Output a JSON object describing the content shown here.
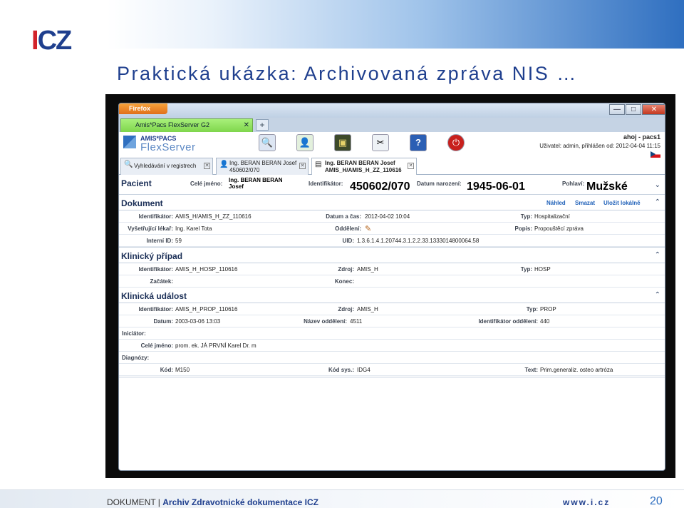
{
  "slide": {
    "logo_left": "I",
    "logo_right": "CZ",
    "title": "Praktická ukázka: Archivovaná zpráva NIS …"
  },
  "browser": {
    "app_button": "Firefox",
    "tab_title": "Amis*Pacs FlexServer G2",
    "new_tab": "+",
    "minimize": "—",
    "maximize": "□",
    "close": "✕"
  },
  "app": {
    "brand_top": "AMIS*PACS",
    "brand_bottom": "FlexServer",
    "tools": [
      {
        "icon": "search-icon",
        "glyph": "🔍"
      },
      {
        "icon": "user-add-icon",
        "glyph": "👤"
      },
      {
        "icon": "monitor-icon",
        "glyph": "▣"
      },
      {
        "icon": "tools-icon",
        "glyph": "✂"
      },
      {
        "icon": "help-icon",
        "glyph": "?"
      },
      {
        "icon": "power-icon",
        "glyph": "⏻"
      }
    ],
    "greeting": "ahoj - pacs1",
    "user_line": "Uživatel: admin, přihlášen od: 2012-04-04 11:15",
    "tabs": [
      {
        "line1": "Vyhledávání v registrech",
        "line2": ""
      },
      {
        "line1": "Ing. BERAN BERAN Josef",
        "line2": "450602/070"
      },
      {
        "line1": "Ing. BERAN BERAN Josef",
        "line2": "AMIS_H/AMIS_H_ZZ_110616"
      }
    ]
  },
  "patient": {
    "title": "Pacient",
    "name_label": "Celé jméno:",
    "name_value_1": "Ing. BERAN BERAN",
    "name_value_2": "Josef",
    "id_label": "Identifikátor:",
    "id_value": "450602/070",
    "dob_label": "Datum narození:",
    "dob_value": "1945-06-01",
    "sex_label": "Pohlaví:",
    "sex_value": "Mužské"
  },
  "document": {
    "title": "Dokument",
    "actions": [
      "Náhled",
      "Smazat",
      "Uložit lokálně"
    ],
    "rows": [
      {
        "l1": "Identifikátor:",
        "v1": "AMIS_H/AMIS_H_ZZ_110616",
        "l2": "Datum a čas:",
        "v2": "2012-04-02 10:04",
        "l3": "Typ:",
        "v3": "Hospitalizační"
      },
      {
        "l1": "Vyšetřující lékař:",
        "v1": "Ing. Karel Tota",
        "l2": "Oddělení:",
        "v2": "✎",
        "l3": "Popis:",
        "v3": "Propouštěcí zpráva"
      },
      {
        "l1": "Interní ID:",
        "v1": "59",
        "l2": "UID:",
        "v2": "1.3.6.1.4.1.20744.3.1.2.2.33.1333014800064.58",
        "l3": "",
        "v3": ""
      }
    ]
  },
  "clinical_case": {
    "title": "Klinický případ",
    "rows": [
      {
        "l1": "Identifikátor:",
        "v1": "AMIS_H_HOSP_110616",
        "l2": "Zdroj:",
        "v2": "AMIS_H",
        "l3": "Typ:",
        "v3": "HOSP"
      },
      {
        "l1": "Začátek:",
        "v1": "",
        "l2": "Konec:",
        "v2": "",
        "l3": "",
        "v3": ""
      }
    ]
  },
  "clinical_event": {
    "title": "Klinická událost",
    "row1": {
      "l1": "Identifikátor:",
      "v1": "AMIS_H_PROP_110616",
      "l2": "Zdroj:",
      "v2": "AMIS_H",
      "l3": "Typ:",
      "v3": "PROP"
    },
    "row2": {
      "l1": "Datum:",
      "v1": "2003-03-06 13:03",
      "l2": "Název oddělení:",
      "v2": "4511",
      "l3": "Identifikátor oddělení:",
      "v3": "440"
    },
    "initiator_label": "Iniciátor:",
    "initiator_name_label": "Celé jméno:",
    "initiator_name_value": "prom. ek. JÁ PRVNÍ Karel Dr. m",
    "diagnoses_label": "Diagnózy:",
    "row_diag": {
      "l1": "Kód:",
      "v1": "M150",
      "l2": "Kód sys.:",
      "v2": "IDG4",
      "l3": "Text:",
      "v3": "Prim.generaliz. osteo artróza"
    }
  },
  "footer": {
    "left_plain": "DOKUMENT | ",
    "left_bold": "Archiv Zdravotnické dokumentace ICZ",
    "url": "www.i.cz",
    "page": "20"
  }
}
